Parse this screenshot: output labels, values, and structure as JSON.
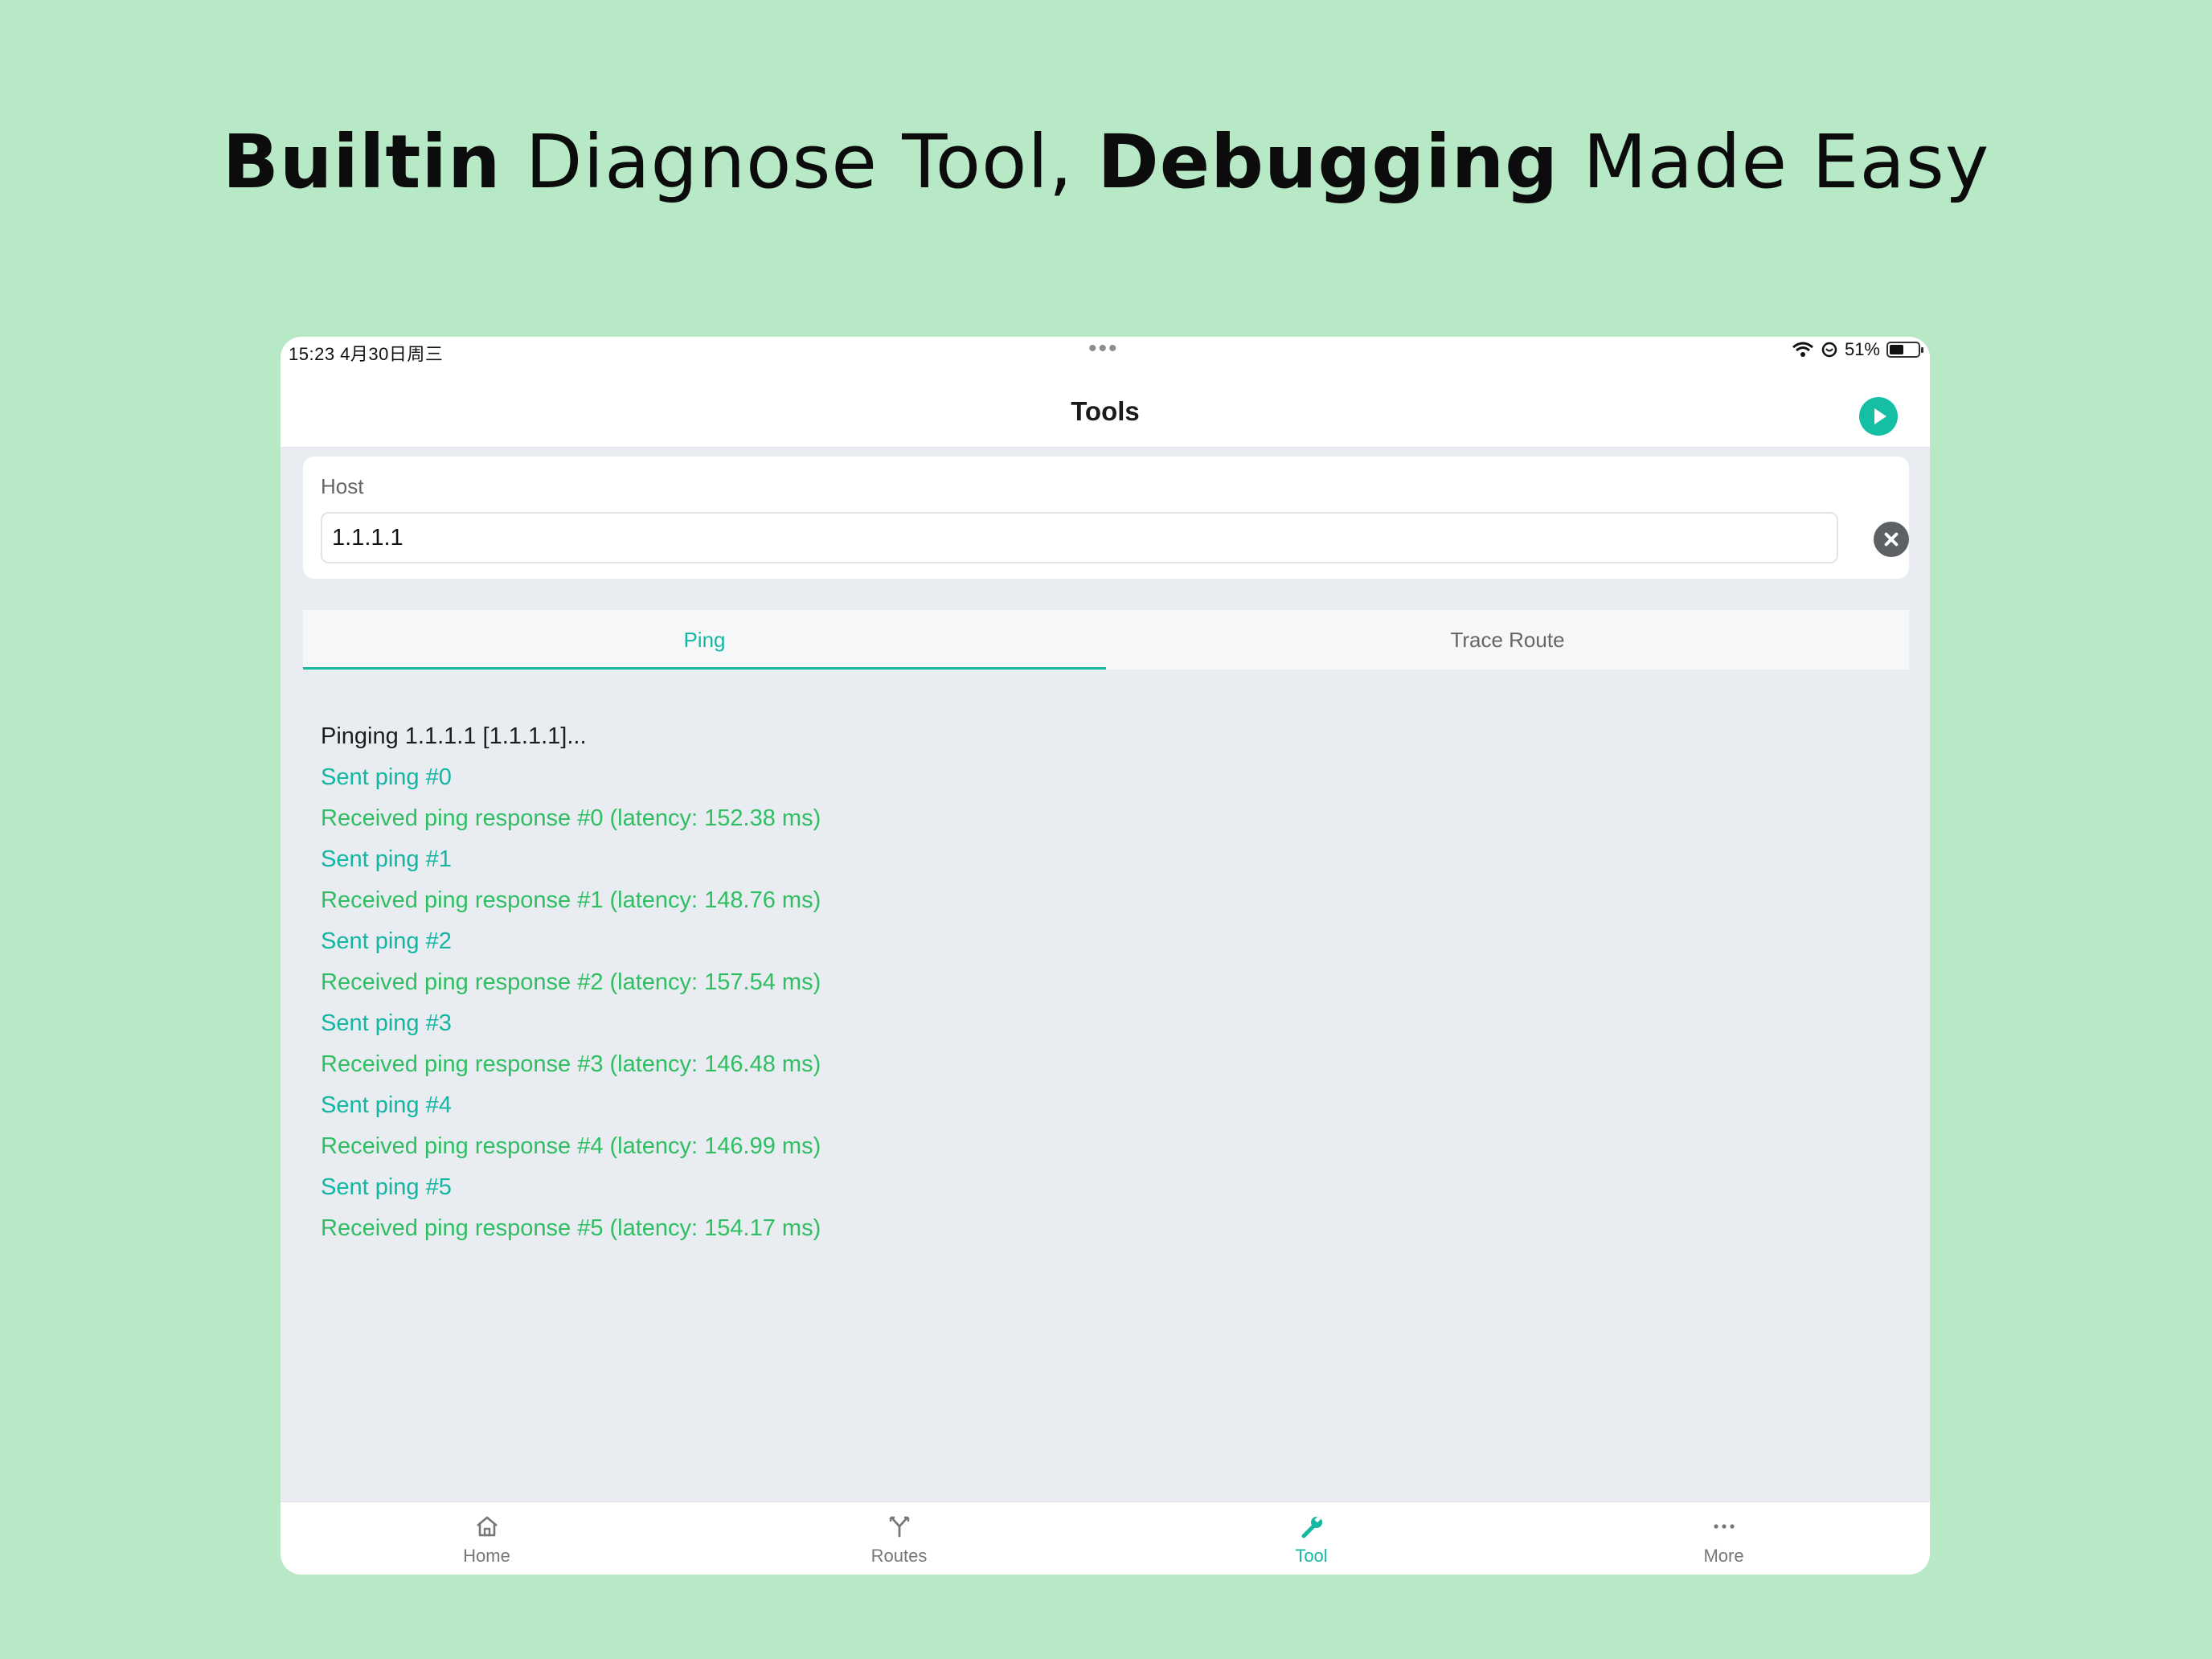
{
  "headline": {
    "part1_bold": "Builtin",
    "part2": " Diagnose Tool, ",
    "part3_bold": "Debugging",
    "part4": " Made Easy"
  },
  "status_bar": {
    "time": "15:23   4月30日周三",
    "dots": "•••",
    "battery_text": "51%",
    "battery_level": 0.51,
    "icons": [
      "wifi-icon",
      "vpn-icon",
      "battery-icon"
    ]
  },
  "nav": {
    "title": "Tools",
    "run_icon": "play-icon"
  },
  "host": {
    "label": "Host",
    "value": "1.1.1.1",
    "clear_icon": "clear-icon"
  },
  "tabs": [
    {
      "label": "Ping",
      "active": true
    },
    {
      "label": "Trace Route",
      "active": false
    }
  ],
  "log": [
    {
      "text": "Pinging 1.1.1.1 [1.1.1.1]...",
      "kind": "plain"
    },
    {
      "text": "Sent ping #0",
      "kind": "sent"
    },
    {
      "text": "Received ping response #0 (latency: 152.38 ms)",
      "kind": "recv"
    },
    {
      "text": "Sent ping #1",
      "kind": "sent"
    },
    {
      "text": "Received ping response #1 (latency: 148.76 ms)",
      "kind": "recv"
    },
    {
      "text": "Sent ping #2",
      "kind": "sent"
    },
    {
      "text": "Received ping response #2 (latency: 157.54 ms)",
      "kind": "recv"
    },
    {
      "text": "Sent ping #3",
      "kind": "sent"
    },
    {
      "text": "Received ping response #3 (latency: 146.48 ms)",
      "kind": "recv"
    },
    {
      "text": "Sent ping #4",
      "kind": "sent"
    },
    {
      "text": "Received ping response #4 (latency: 146.99 ms)",
      "kind": "recv"
    },
    {
      "text": "Sent ping #5",
      "kind": "sent"
    },
    {
      "text": "Received ping response #5 (latency: 154.17 ms)",
      "kind": "recv"
    }
  ],
  "tabbar": [
    {
      "label": "Home",
      "icon": "home-icon",
      "active": false
    },
    {
      "label": "Routes",
      "icon": "routes-icon",
      "active": false
    },
    {
      "label": "Tool",
      "icon": "wrench-icon",
      "active": true
    },
    {
      "label": "More",
      "icon": "more-icon",
      "active": false
    }
  ],
  "colors": {
    "background": "#b7e9c6",
    "accent": "#14b8a3",
    "received": "#2fbe62"
  }
}
